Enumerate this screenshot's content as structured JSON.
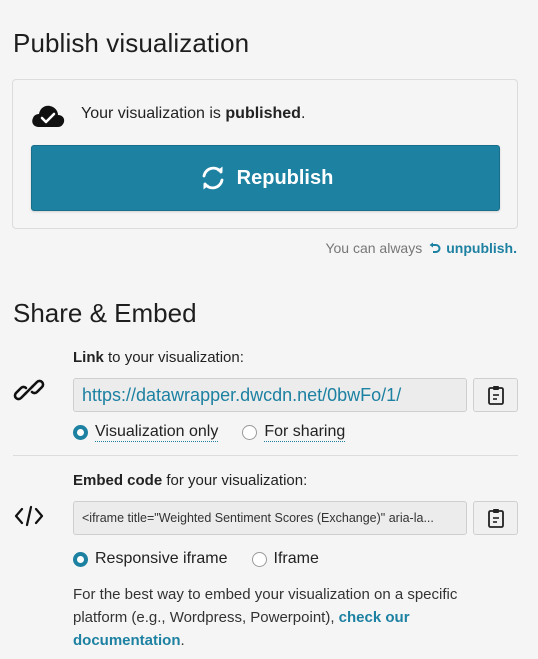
{
  "header": {
    "title": "Publish visualization"
  },
  "status": {
    "prefix": "Your visualization is",
    "state": "published",
    "suffix": ".",
    "republish_label": "Republish"
  },
  "unpublish": {
    "prefix": "You can always",
    "link_label": "unpublish."
  },
  "share": {
    "title": "Share & Embed",
    "link": {
      "label_bold": "Link",
      "label_rest": " to your visualization:",
      "url": "https://datawrapper.dwcdn.net/0bwFo/1/",
      "options": [
        {
          "label": "Visualization only",
          "checked": true
        },
        {
          "label": "For sharing",
          "checked": false
        }
      ]
    },
    "embed": {
      "label_bold": "Embed code",
      "label_rest": " for your visualization:",
      "code": "<iframe title=\"Weighted Sentiment Scores (Exchange)\" aria-la...",
      "options": [
        {
          "label": "Responsive iframe",
          "checked": true
        },
        {
          "label": "Iframe",
          "checked": false
        }
      ]
    },
    "help": {
      "text": "For the best way to embed your visualization on a specific platform (e.g., Wordpress, Powerpoint),",
      "link_label": "check our documentation",
      "suffix": "."
    }
  },
  "colors": {
    "accent": "#1d81a2",
    "background": "#f5f5f5"
  }
}
